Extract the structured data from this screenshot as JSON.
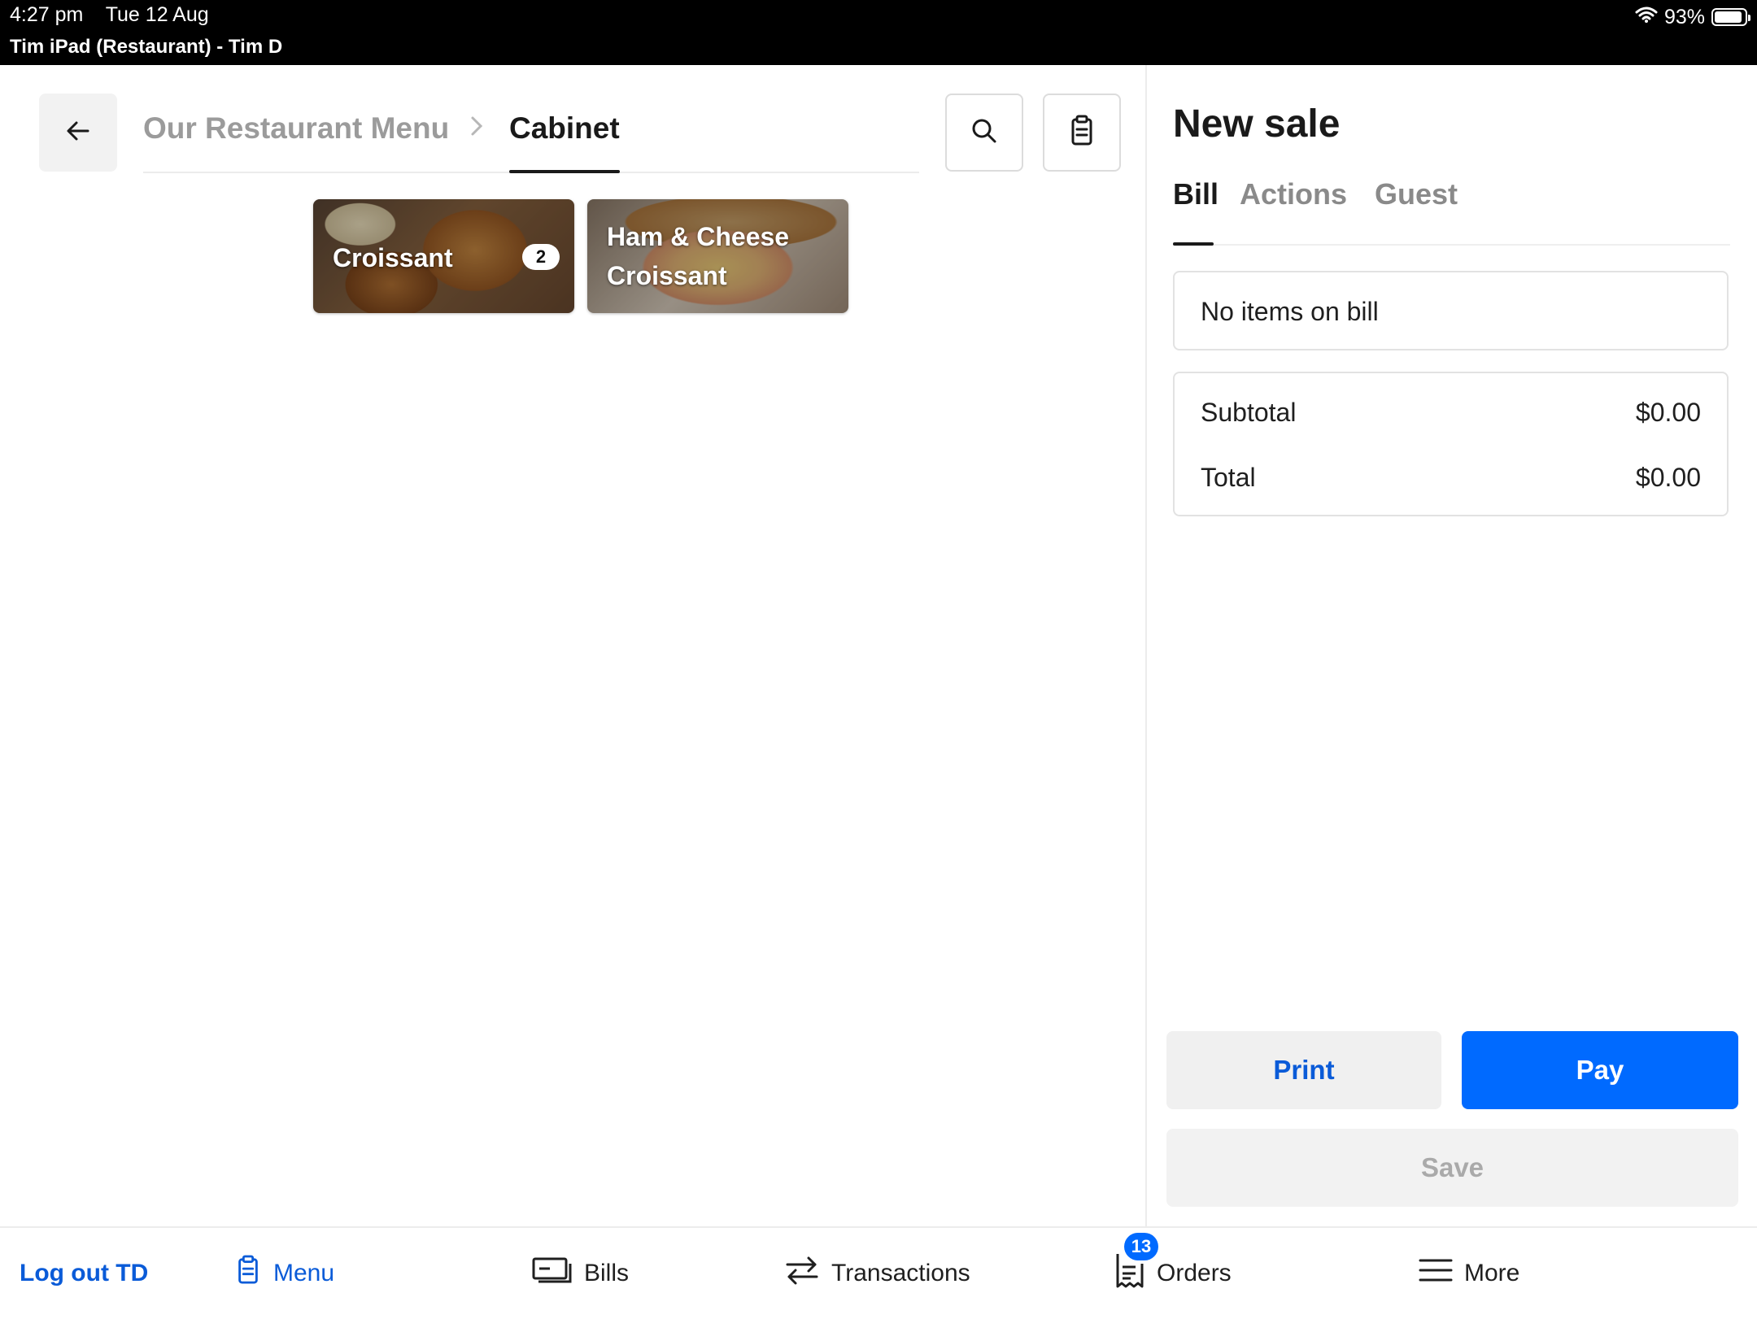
{
  "status_bar": {
    "time": "4:27 pm",
    "date": "Tue 12 Aug",
    "device": "Tim iPad (Restaurant) - Tim D",
    "battery": "93%",
    "battery_level": 0.93,
    "icons": [
      "wifi-icon",
      "battery-icon"
    ]
  },
  "breadcrumb": {
    "parent": "Our Restaurant Menu",
    "separator": ">",
    "current": "Cabinet"
  },
  "toolbar": {
    "icons": [
      "back-arrow-icon",
      "search-icon",
      "clipboard-icon"
    ]
  },
  "menu_items": [
    {
      "name": "Croissant",
      "badge": "2"
    },
    {
      "name": "Ham & Cheese Croissant",
      "line1": "Ham & Cheese",
      "line2": "Croissant"
    }
  ],
  "sale": {
    "title": "New sale",
    "tabs": [
      "Bill",
      "Actions",
      "Guest"
    ],
    "active_tab": "Bill",
    "empty_text": "No items on bill",
    "subtotal_label": "Subtotal",
    "subtotal_value": "$0.00",
    "total_label": "Total",
    "total_value": "$0.00",
    "print_label": "Print",
    "pay_label": "Pay",
    "save_label": "Save"
  },
  "nav": {
    "logout": "Log out TD",
    "menu": "Menu",
    "bills": "Bills",
    "transactions": "Transactions",
    "orders": "Orders",
    "orders_badge": "13",
    "more": "More"
  },
  "colors": {
    "accent": "#006aff",
    "link": "#0a5bd8",
    "status_bar": "#000000"
  }
}
